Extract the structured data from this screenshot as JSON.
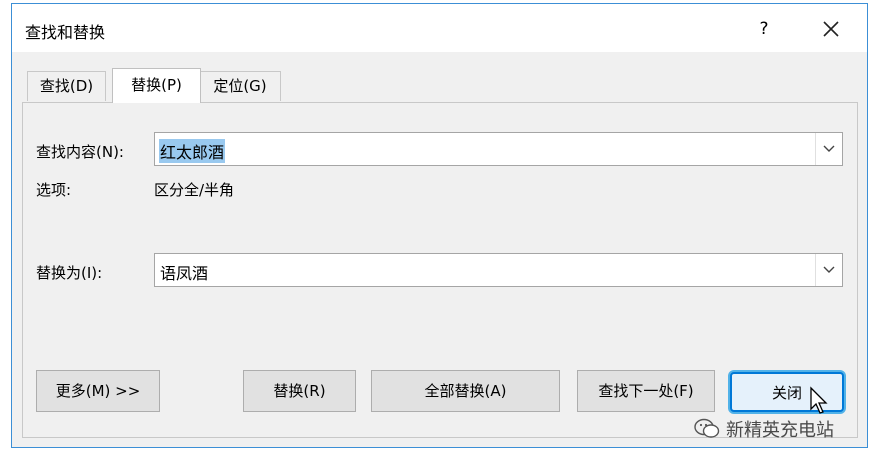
{
  "dialog": {
    "title": "查找和替换",
    "help_label": "?",
    "tabs": [
      {
        "label": "查找(D)"
      },
      {
        "label": "替换(P)"
      },
      {
        "label": "定位(G)"
      }
    ],
    "find": {
      "label": "查找内容(N):",
      "value": "红太郎酒"
    },
    "options": {
      "label": "选项:",
      "value": "区分全/半角"
    },
    "replace": {
      "label": "替换为(I):",
      "value": "语凤酒"
    },
    "buttons": {
      "more": "更多(M) >>",
      "replace": "替换(R)",
      "replace_all": "全部替换(A)",
      "find_next": "查找下一处(F)",
      "close": "关闭"
    }
  },
  "watermark": {
    "text": "新精英充电站",
    "icon": "wechat-icon"
  },
  "colors": {
    "accent": "#0078d7",
    "selection": "#99c9ef",
    "dialog_bg": "#f0f0f0"
  }
}
